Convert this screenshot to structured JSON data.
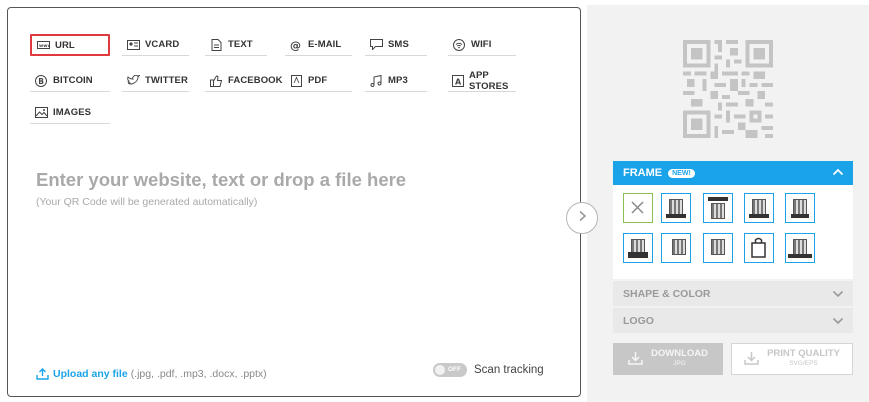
{
  "qr_types": [
    {
      "label": "URL",
      "icon": "url-icon",
      "selected": true
    },
    {
      "label": "VCARD",
      "icon": "vcard-icon"
    },
    {
      "label": "TEXT",
      "icon": "text-icon"
    },
    {
      "label": "E-MAIL",
      "icon": "at-icon"
    },
    {
      "label": "SMS",
      "icon": "sms-icon"
    },
    {
      "label": "WIFI",
      "icon": "wifi-icon"
    },
    {
      "label": "BITCOIN",
      "icon": "bitcoin-icon"
    },
    {
      "label": "TWITTER",
      "icon": "twitter-icon"
    },
    {
      "label": "FACEBOOK",
      "icon": "facebook-like-icon"
    },
    {
      "label": "PDF",
      "icon": "pdf-icon"
    },
    {
      "label": "MP3",
      "icon": "music-icon"
    },
    {
      "label": "APP STORES",
      "icon": "app-store-icon"
    },
    {
      "label": "IMAGES",
      "icon": "image-icon"
    }
  ],
  "main": {
    "drop_title": "Enter your website, text or drop a file here",
    "drop_subtitle": "(Your QR Code will be generated automatically)",
    "upload_link": "Upload any file",
    "upload_types": "(.jpg, .pdf, .mp3, .docx, .pptx)",
    "toggle_state": "OFF",
    "scan_tracking": "Scan tracking"
  },
  "frame": {
    "title": "FRAME",
    "badge": "NEW!",
    "options": [
      "none",
      "frame-1",
      "frame-2",
      "frame-3",
      "frame-4",
      "frame-5",
      "frame-6",
      "frame-7",
      "frame-8",
      "frame-9"
    ]
  },
  "sections": {
    "shape_color": "SHAPE & COLOR",
    "logo": "LOGO"
  },
  "buttons": {
    "download": "DOWNLOAD",
    "download_sub": "JPG",
    "print": "PRINT QUALITY",
    "print_sub": "SVG/EPS"
  },
  "colors": {
    "accent": "#1aa3e8",
    "selected_border": "#e0393e",
    "no_frame_border": "#8ec153"
  }
}
